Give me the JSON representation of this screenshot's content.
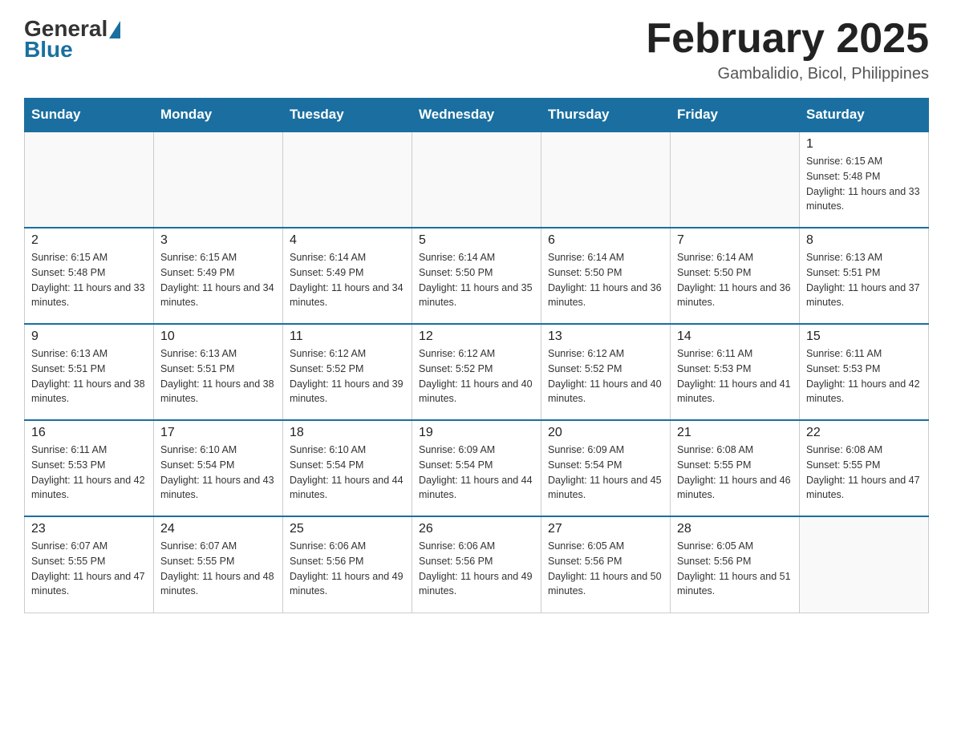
{
  "logo": {
    "general": "General",
    "blue": "Blue"
  },
  "header": {
    "month_year": "February 2025",
    "location": "Gambalidio, Bicol, Philippines"
  },
  "days_of_week": [
    "Sunday",
    "Monday",
    "Tuesday",
    "Wednesday",
    "Thursday",
    "Friday",
    "Saturday"
  ],
  "weeks": [
    [
      null,
      null,
      null,
      null,
      null,
      null,
      {
        "day": "1",
        "sunrise": "Sunrise: 6:15 AM",
        "sunset": "Sunset: 5:48 PM",
        "daylight": "Daylight: 11 hours and 33 minutes."
      }
    ],
    [
      {
        "day": "2",
        "sunrise": "Sunrise: 6:15 AM",
        "sunset": "Sunset: 5:48 PM",
        "daylight": "Daylight: 11 hours and 33 minutes."
      },
      {
        "day": "3",
        "sunrise": "Sunrise: 6:15 AM",
        "sunset": "Sunset: 5:49 PM",
        "daylight": "Daylight: 11 hours and 34 minutes."
      },
      {
        "day": "4",
        "sunrise": "Sunrise: 6:14 AM",
        "sunset": "Sunset: 5:49 PM",
        "daylight": "Daylight: 11 hours and 34 minutes."
      },
      {
        "day": "5",
        "sunrise": "Sunrise: 6:14 AM",
        "sunset": "Sunset: 5:50 PM",
        "daylight": "Daylight: 11 hours and 35 minutes."
      },
      {
        "day": "6",
        "sunrise": "Sunrise: 6:14 AM",
        "sunset": "Sunset: 5:50 PM",
        "daylight": "Daylight: 11 hours and 36 minutes."
      },
      {
        "day": "7",
        "sunrise": "Sunrise: 6:14 AM",
        "sunset": "Sunset: 5:50 PM",
        "daylight": "Daylight: 11 hours and 36 minutes."
      },
      {
        "day": "8",
        "sunrise": "Sunrise: 6:13 AM",
        "sunset": "Sunset: 5:51 PM",
        "daylight": "Daylight: 11 hours and 37 minutes."
      }
    ],
    [
      {
        "day": "9",
        "sunrise": "Sunrise: 6:13 AM",
        "sunset": "Sunset: 5:51 PM",
        "daylight": "Daylight: 11 hours and 38 minutes."
      },
      {
        "day": "10",
        "sunrise": "Sunrise: 6:13 AM",
        "sunset": "Sunset: 5:51 PM",
        "daylight": "Daylight: 11 hours and 38 minutes."
      },
      {
        "day": "11",
        "sunrise": "Sunrise: 6:12 AM",
        "sunset": "Sunset: 5:52 PM",
        "daylight": "Daylight: 11 hours and 39 minutes."
      },
      {
        "day": "12",
        "sunrise": "Sunrise: 6:12 AM",
        "sunset": "Sunset: 5:52 PM",
        "daylight": "Daylight: 11 hours and 40 minutes."
      },
      {
        "day": "13",
        "sunrise": "Sunrise: 6:12 AM",
        "sunset": "Sunset: 5:52 PM",
        "daylight": "Daylight: 11 hours and 40 minutes."
      },
      {
        "day": "14",
        "sunrise": "Sunrise: 6:11 AM",
        "sunset": "Sunset: 5:53 PM",
        "daylight": "Daylight: 11 hours and 41 minutes."
      },
      {
        "day": "15",
        "sunrise": "Sunrise: 6:11 AM",
        "sunset": "Sunset: 5:53 PM",
        "daylight": "Daylight: 11 hours and 42 minutes."
      }
    ],
    [
      {
        "day": "16",
        "sunrise": "Sunrise: 6:11 AM",
        "sunset": "Sunset: 5:53 PM",
        "daylight": "Daylight: 11 hours and 42 minutes."
      },
      {
        "day": "17",
        "sunrise": "Sunrise: 6:10 AM",
        "sunset": "Sunset: 5:54 PM",
        "daylight": "Daylight: 11 hours and 43 minutes."
      },
      {
        "day": "18",
        "sunrise": "Sunrise: 6:10 AM",
        "sunset": "Sunset: 5:54 PM",
        "daylight": "Daylight: 11 hours and 44 minutes."
      },
      {
        "day": "19",
        "sunrise": "Sunrise: 6:09 AM",
        "sunset": "Sunset: 5:54 PM",
        "daylight": "Daylight: 11 hours and 44 minutes."
      },
      {
        "day": "20",
        "sunrise": "Sunrise: 6:09 AM",
        "sunset": "Sunset: 5:54 PM",
        "daylight": "Daylight: 11 hours and 45 minutes."
      },
      {
        "day": "21",
        "sunrise": "Sunrise: 6:08 AM",
        "sunset": "Sunset: 5:55 PM",
        "daylight": "Daylight: 11 hours and 46 minutes."
      },
      {
        "day": "22",
        "sunrise": "Sunrise: 6:08 AM",
        "sunset": "Sunset: 5:55 PM",
        "daylight": "Daylight: 11 hours and 47 minutes."
      }
    ],
    [
      {
        "day": "23",
        "sunrise": "Sunrise: 6:07 AM",
        "sunset": "Sunset: 5:55 PM",
        "daylight": "Daylight: 11 hours and 47 minutes."
      },
      {
        "day": "24",
        "sunrise": "Sunrise: 6:07 AM",
        "sunset": "Sunset: 5:55 PM",
        "daylight": "Daylight: 11 hours and 48 minutes."
      },
      {
        "day": "25",
        "sunrise": "Sunrise: 6:06 AM",
        "sunset": "Sunset: 5:56 PM",
        "daylight": "Daylight: 11 hours and 49 minutes."
      },
      {
        "day": "26",
        "sunrise": "Sunrise: 6:06 AM",
        "sunset": "Sunset: 5:56 PM",
        "daylight": "Daylight: 11 hours and 49 minutes."
      },
      {
        "day": "27",
        "sunrise": "Sunrise: 6:05 AM",
        "sunset": "Sunset: 5:56 PM",
        "daylight": "Daylight: 11 hours and 50 minutes."
      },
      {
        "day": "28",
        "sunrise": "Sunrise: 6:05 AM",
        "sunset": "Sunset: 5:56 PM",
        "daylight": "Daylight: 11 hours and 51 minutes."
      },
      null
    ]
  ]
}
